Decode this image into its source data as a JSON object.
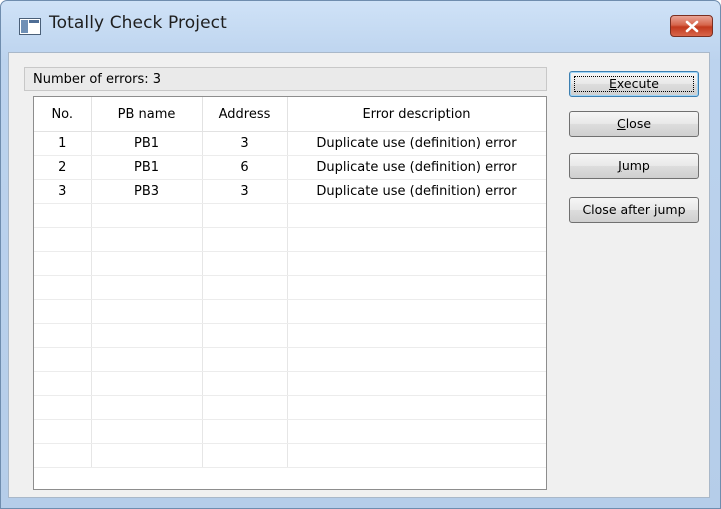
{
  "window": {
    "title": "Totally Check Project",
    "close_symbol": "×"
  },
  "error_count_text": "Number of errors: 3",
  "table": {
    "columns": [
      "No.",
      "PB name",
      "Address",
      "Error description"
    ],
    "rows": [
      [
        "1",
        "PB1",
        "3",
        "Duplicate use (definition) error"
      ],
      [
        "2",
        "PB1",
        "6",
        "Duplicate use (definition) error"
      ],
      [
        "3",
        "PB3",
        "3",
        "Duplicate use (definition) error"
      ],
      [
        "",
        "",
        "",
        ""
      ],
      [
        "",
        "",
        "",
        ""
      ],
      [
        "",
        "",
        "",
        ""
      ],
      [
        "",
        "",
        "",
        ""
      ],
      [
        "",
        "",
        "",
        ""
      ],
      [
        "",
        "",
        "",
        ""
      ],
      [
        "",
        "",
        "",
        ""
      ],
      [
        "",
        "",
        "",
        ""
      ],
      [
        "",
        "",
        "",
        ""
      ],
      [
        "",
        "",
        "",
        ""
      ],
      [
        "",
        "",
        "",
        ""
      ]
    ]
  },
  "buttons": {
    "execute": {
      "mnemonic": "E",
      "rest": "xecute"
    },
    "close": {
      "mnemonic": "C",
      "rest": "lose"
    },
    "jump": {
      "mnemonic": "J",
      "rest": "ump"
    },
    "close_after_jump": "Close after jump"
  },
  "colors": {
    "title_close_red": "#c2391d",
    "default_button_border": "#3c7fb1"
  }
}
